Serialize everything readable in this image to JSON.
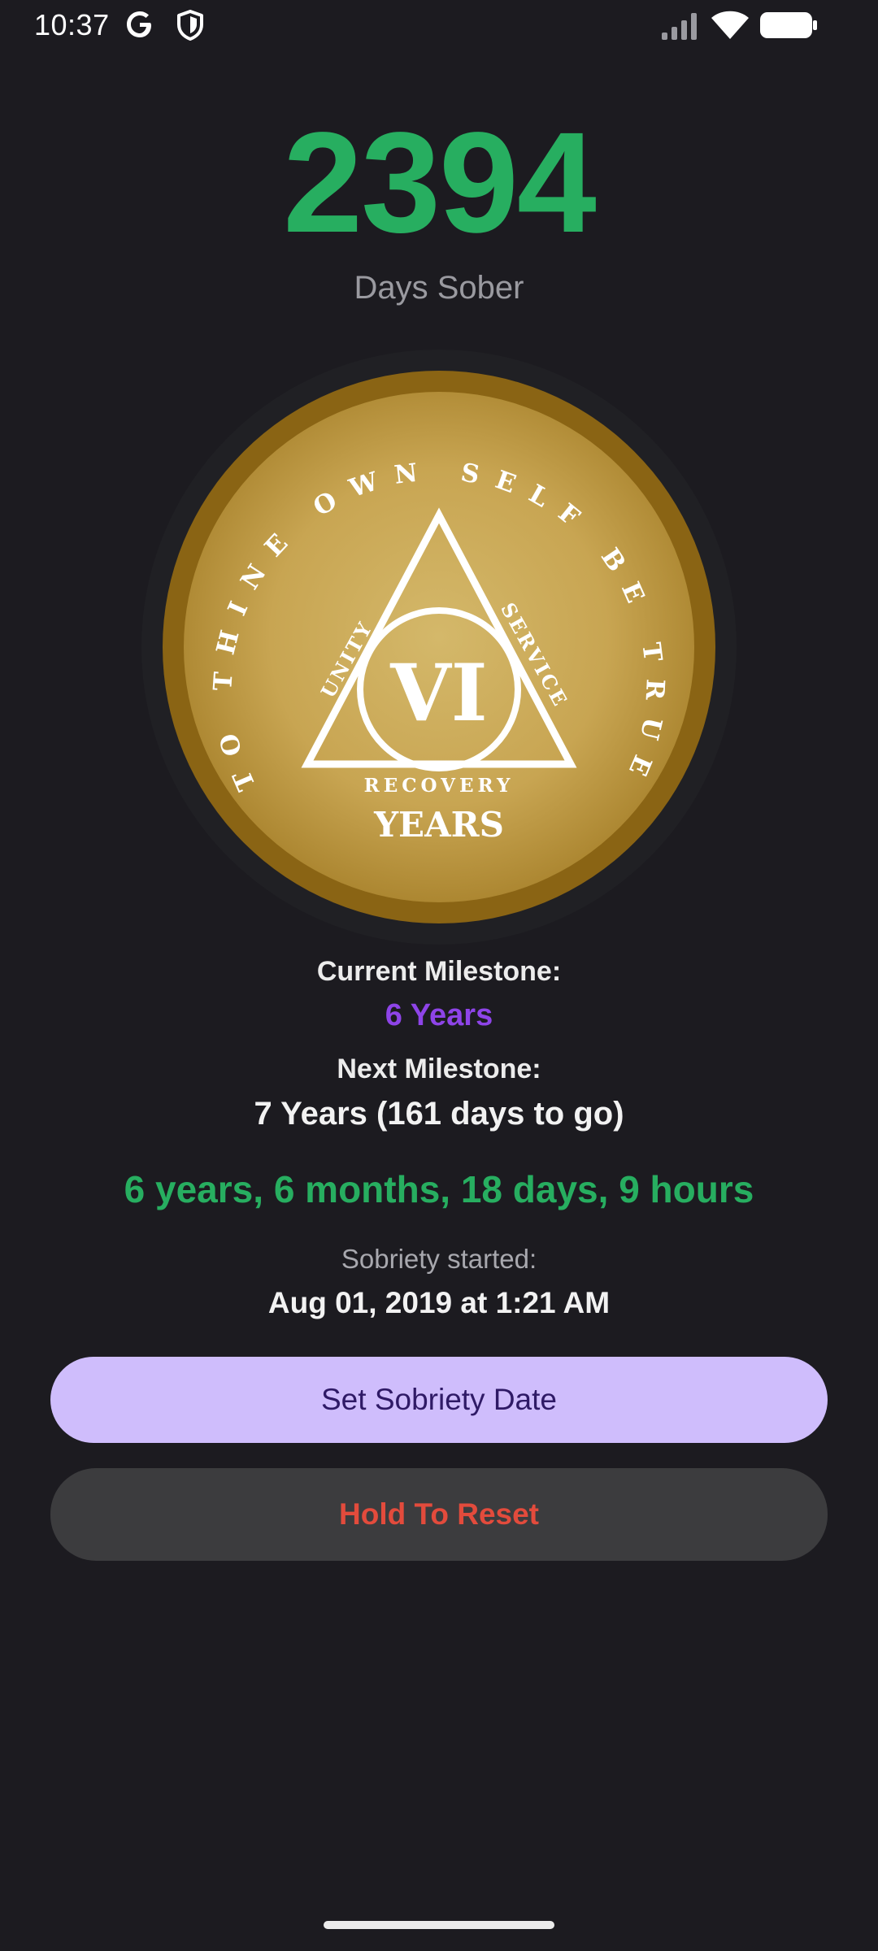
{
  "status_bar": {
    "time": "10:37",
    "icons": [
      "google-icon",
      "shield-icon",
      "signal-icon",
      "wifi-icon",
      "battery-icon"
    ]
  },
  "counter": {
    "days": "2394",
    "label": "Days Sober"
  },
  "medallion": {
    "motto": "TO THINE OWN SELF BE TRUE",
    "left_side": "UNITY",
    "right_side": "SERVICE",
    "bottom_side": "RECOVERY",
    "numeral": "VI",
    "years_label": "YEARS",
    "colors": {
      "rim": "#8a6414",
      "face": "#c8a552",
      "text": "#ffffff"
    }
  },
  "milestones": {
    "current_label": "Current Milestone:",
    "current_value": "6 Years",
    "next_label": "Next Milestone:",
    "next_value": "7 Years (161 days to go)"
  },
  "duration": "6 years, 6 months, 18 days, 9 hours",
  "started": {
    "label": "Sobriety started:",
    "value": "Aug 01, 2019 at 1:21 AM"
  },
  "buttons": {
    "set_date": "Set Sobriety Date",
    "reset": "Hold To Reset"
  },
  "colors": {
    "accent_green": "#27ae60",
    "accent_purple": "#8e44e8",
    "button_primary": "#cfbdfc",
    "reset_red": "#e34b3c",
    "background": "#1c1b20"
  }
}
